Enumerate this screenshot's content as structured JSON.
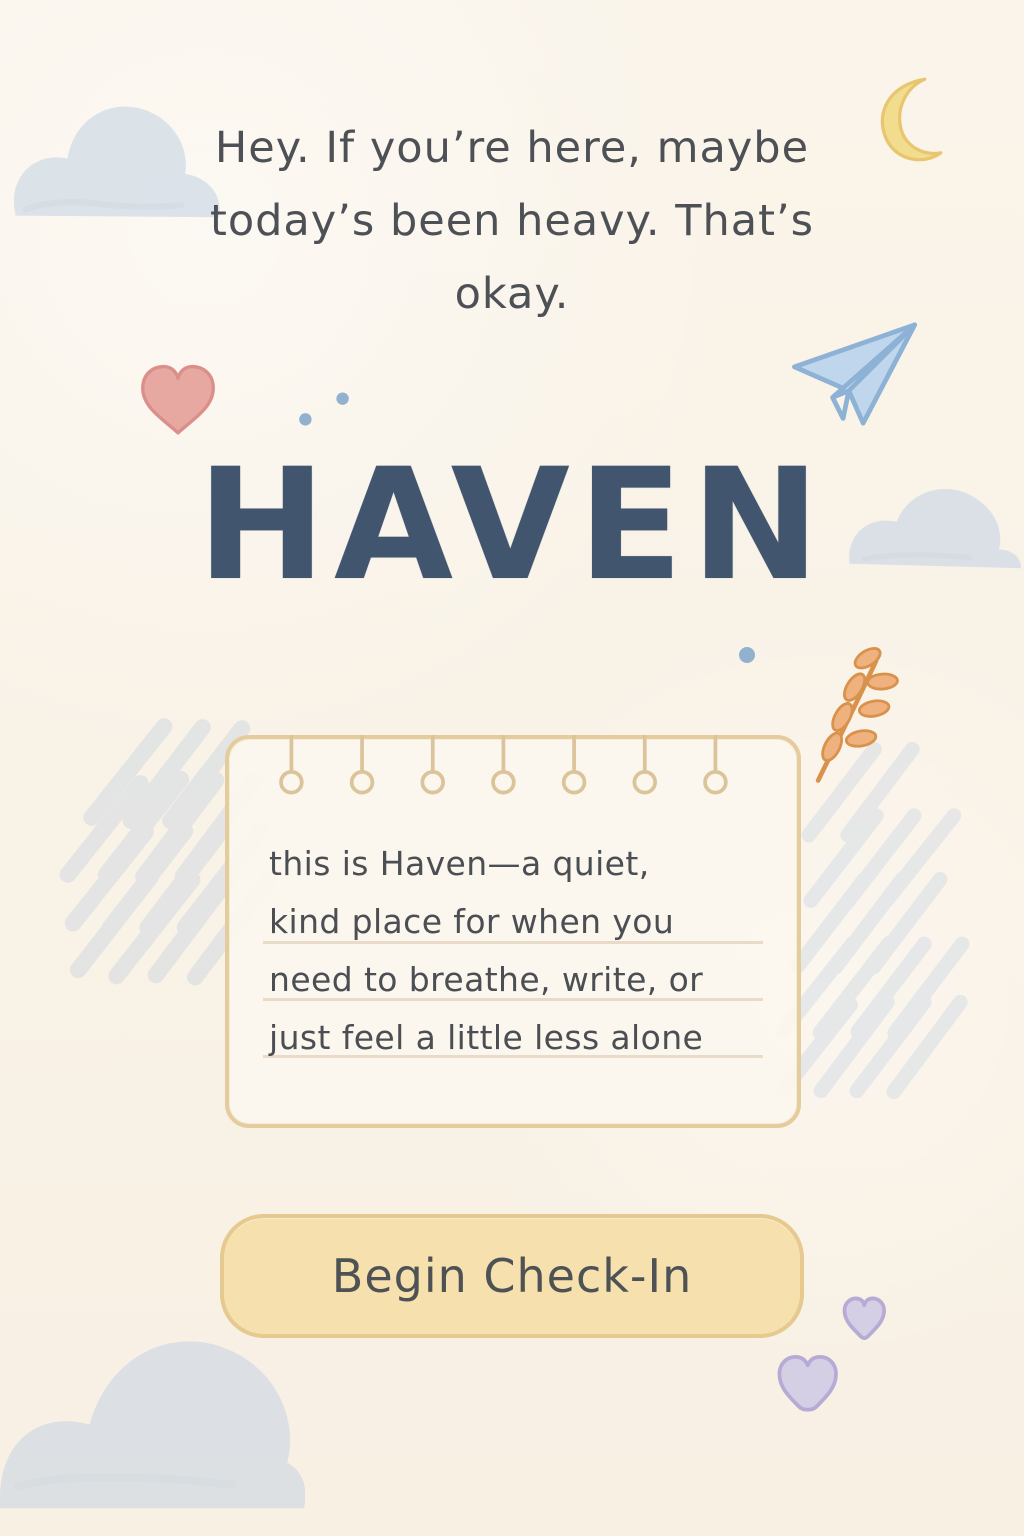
{
  "intro": {
    "text": "Hey. If you’re here, maybe today’s been heavy. That’s okay."
  },
  "brand": {
    "title": "HAVEN"
  },
  "note": {
    "text": "this is Haven—a quiet,\nkind place for when you\nneed to breathe, write, or\njust feel a little less alone"
  },
  "action": {
    "label": "Begin Check-In"
  },
  "icons": {
    "top_right": "moon-icon",
    "upper_left": "heart-icon",
    "upper_right": "paper-plane-icon",
    "middle_right": "leaf-icon",
    "bottom_right": "small-hearts-icon",
    "background": "cloud-icon"
  },
  "colors": {
    "background": "#f9f2e6",
    "title": "#41556f",
    "text": "#4d5156",
    "card_border": "#e4cc9d",
    "button_fill": "#f6e0ad",
    "moon": "#f2dc8e",
    "heart": "#e59a98",
    "plane": "#a8c4df",
    "leaf": "#df9a55",
    "lavender_heart": "#c8bfe0",
    "cloud": "#c8d6e4"
  }
}
